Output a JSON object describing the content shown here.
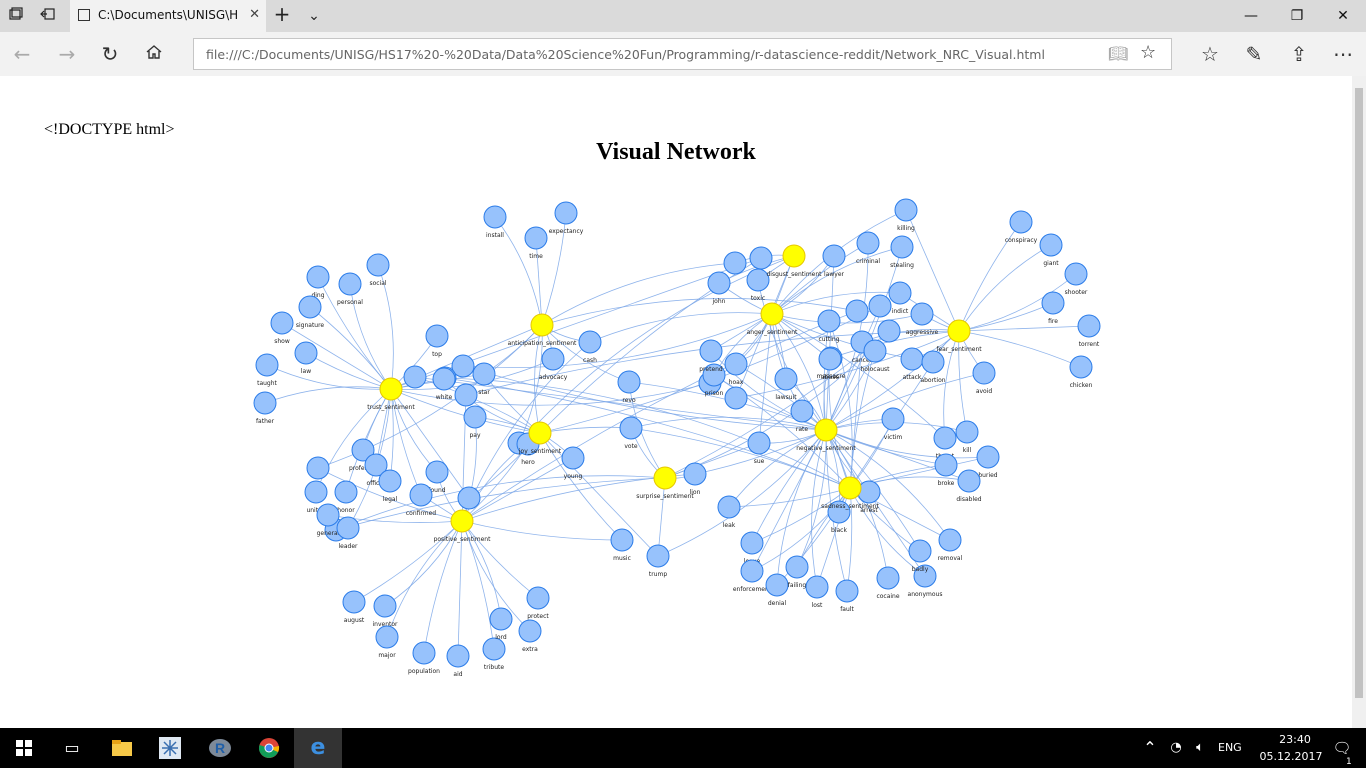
{
  "browser": {
    "tab_title": "C:\\Documents\\UNISG\\H",
    "address": "file:///C:/Documents/UNISG/HS17%20-%20Data/Data%20Science%20Fun/Programming/r-datascience-reddit/Network_NRC_Visual.html",
    "icons": {
      "tabs_aside": "tabs-aside-icon",
      "set_aside": "set-aside-icon",
      "new_tab": "plus-icon",
      "tab_menu": "chevron-down-icon",
      "back": "back-arrow-icon",
      "forward": "forward-arrow-icon",
      "refresh": "refresh-icon",
      "home": "home-icon",
      "reading_view": "book-icon",
      "favorite": "star-icon",
      "favorites_hub": "favorites-list-icon",
      "notes": "pen-icon",
      "share": "share-icon",
      "more": "ellipsis-icon"
    }
  },
  "page": {
    "doctype_text": "<!DOCTYPE html>",
    "title": "Visual Network"
  },
  "network": {
    "colors": {
      "sentiment_fill": "#ffff00",
      "sentiment_stroke": "#e6c700",
      "word_fill": "#97c2fc",
      "word_stroke": "#2b7ce9",
      "edge": "#7aa6e8"
    },
    "sentiment_nodes": [
      "trust_sentiment",
      "anticipation_sentiment",
      "joy_sentiment",
      "positive_sentiment",
      "surprise_sentiment",
      "disgust_sentiment",
      "anger_sentiment",
      "fear_sentiment",
      "negative_sentiment",
      "sadness_sentiment"
    ],
    "word_nodes": [
      "install",
      "expectancy",
      "time",
      "ding",
      "personal",
      "social",
      "signature",
      "show",
      "law",
      "taught",
      "father",
      "top",
      "white",
      "star",
      "advocacy",
      "cash",
      "pay",
      "hero",
      "young",
      "vote",
      "revo",
      "professor",
      "officer",
      "legal",
      "found",
      "united",
      "honor",
      "confirmed",
      "general",
      "leader",
      "lion",
      "music",
      "trump",
      "august",
      "inventor",
      "major",
      "population",
      "aid",
      "tribute",
      "lord",
      "extra",
      "protect",
      "killing",
      "criminal",
      "stealing",
      "lawyer",
      "john",
      "toxic",
      "cutting",
      "massacre",
      "cancer",
      "holocaust",
      "indict",
      "aggressive",
      "attack",
      "abortion",
      "avoid",
      "abuse",
      "prison",
      "pretend",
      "lawsuit",
      "hoax",
      "rate",
      "victim",
      "sue",
      "threat",
      "kill",
      "buried",
      "broke",
      "disabled",
      "leak",
      "black",
      "arrest",
      "leave",
      "enforcement",
      "denial",
      "failing",
      "lost",
      "fault",
      "cocaine",
      "anonymous",
      "badly",
      "removal",
      "conspiracy",
      "giant",
      "shooter",
      "fire",
      "torrent",
      "chicken"
    ]
  },
  "taskbar": {
    "icons": {
      "start": "windows-start-icon",
      "task_view": "task-view-icon",
      "explorer": "file-explorer-icon",
      "app2": "snowflake-icon",
      "r": "r-app-icon",
      "chrome": "chrome-icon",
      "edge": "edge-icon",
      "chevron": "chevron-up-icon",
      "network": "wifi-icon",
      "volume": "volume-icon",
      "notifications": "notification-icon"
    },
    "language": "ENG",
    "time": "23:40",
    "date": "05.12.2017",
    "notification_count": "1"
  }
}
